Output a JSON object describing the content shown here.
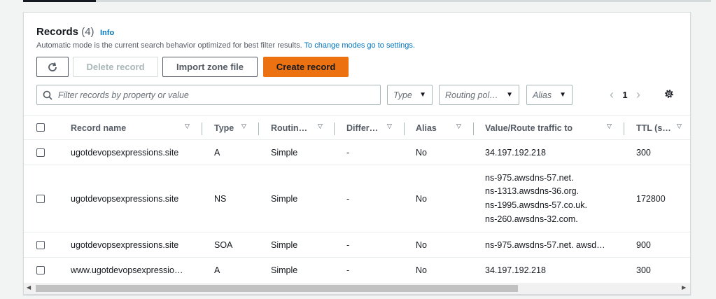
{
  "header": {
    "title": "Records",
    "count": "(4)",
    "info_label": "Info",
    "description": "Automatic mode is the current search behavior optimized for best filter results.",
    "description_link": "To change modes go to settings."
  },
  "toolbar": {
    "delete_label": "Delete record",
    "import_label": "Import zone file",
    "create_label": "Create record"
  },
  "filter": {
    "search_placeholder": "Filter records by property or value",
    "type_label": "Type",
    "routing_label": "Routing pol…",
    "alias_label": "Alias"
  },
  "pagination": {
    "current_page": "1"
  },
  "table": {
    "columns": [
      "Record name",
      "Type",
      "Routin…",
      "Differ…",
      "Alias",
      "Value/Route traffic to",
      "TTL (s…"
    ],
    "rows": [
      {
        "name": "ugotdevopsexpressions.site",
        "type": "A",
        "routing": "Simple",
        "differ": "-",
        "alias": "No",
        "value": [
          "34.197.192.218"
        ],
        "ttl": "300"
      },
      {
        "name": "ugotdevopsexpressions.site",
        "type": "NS",
        "routing": "Simple",
        "differ": "-",
        "alias": "No",
        "value": [
          "ns-975.awsdns-57.net.",
          "ns-1313.awsdns-36.org.",
          "ns-1995.awsdns-57.co.uk.",
          "ns-260.awsdns-32.com."
        ],
        "ttl": "172800"
      },
      {
        "name": "ugotdevopsexpressions.site",
        "type": "SOA",
        "routing": "Simple",
        "differ": "-",
        "alias": "No",
        "value": [
          "ns-975.awsdns-57.net. awsd…"
        ],
        "ttl": "900"
      },
      {
        "name": "www.ugotdevopsexpressio…",
        "type": "A",
        "routing": "Simple",
        "differ": "-",
        "alias": "No",
        "value": [
          "34.197.192.218"
        ],
        "ttl": "300"
      }
    ]
  },
  "colors": {
    "primary_button": "#ec7211",
    "link": "#0073bb"
  }
}
